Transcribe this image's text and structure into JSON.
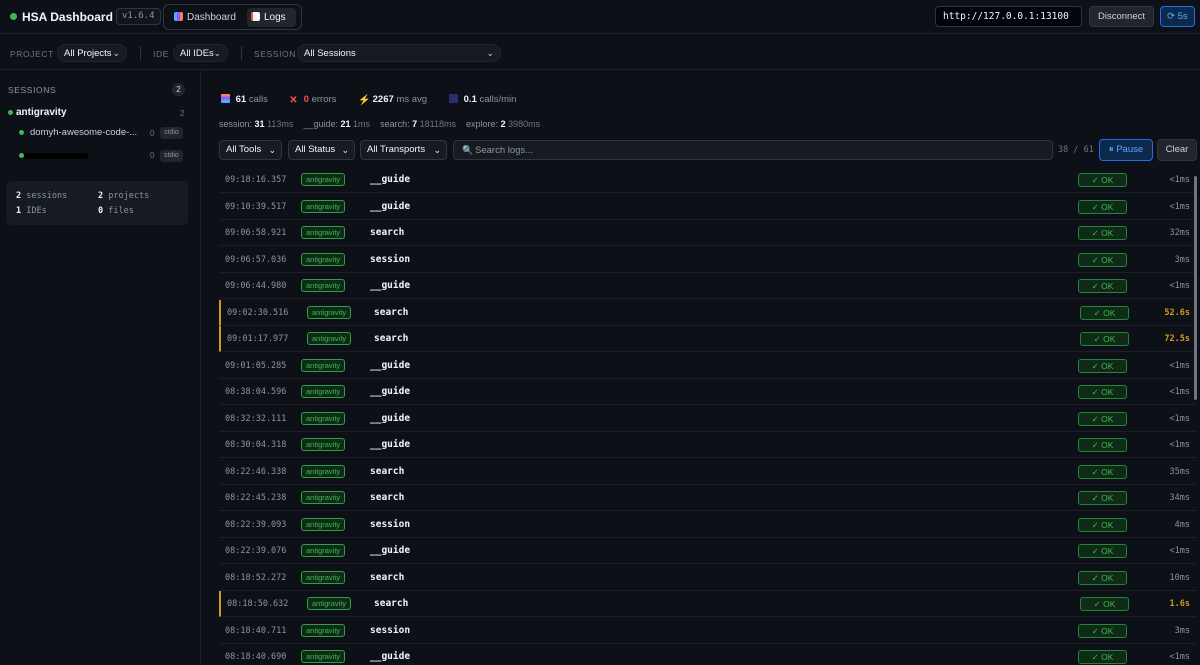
{
  "header": {
    "title": "HSA Dashboard",
    "version": "v1.6.4",
    "nav": [
      {
        "label": "Dashboard",
        "icon": "chart-icon"
      },
      {
        "label": "Logs",
        "icon": "logs-icon",
        "active": true
      }
    ],
    "server_url": "http://127.0.0.1:13100",
    "disconnect_label": "Disconnect",
    "refresh_label": "⟳ 5s"
  },
  "filters": {
    "project_label": "PROJECT",
    "project_value": "All Projects",
    "ide_label": "IDE",
    "ide_value": "All IDEs",
    "session_label": "SESSION",
    "session_value": "All Sessions"
  },
  "sidebar": {
    "title": "SESSIONS",
    "count": "2",
    "group": {
      "name": "antigravity",
      "count": "2"
    },
    "items": [
      {
        "name": "domyh-awesome-code-...",
        "num": "0",
        "badge": "stdio"
      },
      {
        "name": "",
        "num": "0",
        "badge": "stdio",
        "redacted": true
      }
    ],
    "stats": {
      "sessions_num": "2",
      "sessions_label": "sessions",
      "projects_num": "2",
      "projects_label": "projects",
      "ides_num": "1",
      "ides_label": "IDEs",
      "files_num": "0",
      "files_label": "files"
    }
  },
  "summary": {
    "calls_num": "61",
    "calls_label": "calls",
    "errors_num": "0",
    "errors_label": "errors",
    "avg_num": "2267",
    "avg_label": "ms avg",
    "rate_num": "0.1",
    "rate_label": "calls/min"
  },
  "breakdown": [
    {
      "name": "session:",
      "count": "31",
      "time": "113ms"
    },
    {
      "name": "__guide:",
      "count": "21",
      "time": "1ms"
    },
    {
      "name": "search:",
      "count": "7",
      "time": "18118ms"
    },
    {
      "name": "explore:",
      "count": "2",
      "time": "3980ms"
    }
  ],
  "toolbar": {
    "tools": "All Tools",
    "status": "All Status",
    "transports": "All Transports",
    "search_placeholder": "Search logs...",
    "count": "38 / 61",
    "pause": "⏸ Pause",
    "clear": "Clear"
  },
  "logs": [
    {
      "time": "09:18:16.357",
      "ide": "antigravity",
      "tool": "__guide",
      "status": "✓ OK",
      "duration": "<1ms",
      "slow": false
    },
    {
      "time": "09:10:39.517",
      "ide": "antigravity",
      "tool": "__guide",
      "status": "✓ OK",
      "duration": "<1ms",
      "slow": false
    },
    {
      "time": "09:06:58.921",
      "ide": "antigravity",
      "tool": "search",
      "status": "✓ OK",
      "duration": "32ms",
      "slow": false
    },
    {
      "time": "09:06:57.036",
      "ide": "antigravity",
      "tool": "session",
      "status": "✓ OK",
      "duration": "3ms",
      "slow": false
    },
    {
      "time": "09:06:44.980",
      "ide": "antigravity",
      "tool": "__guide",
      "status": "✓ OK",
      "duration": "<1ms",
      "slow": false
    },
    {
      "time": "09:02:30.516",
      "ide": "antigravity",
      "tool": "search",
      "status": "✓ OK",
      "duration": "52.6s",
      "slow": true
    },
    {
      "time": "09:01:17.977",
      "ide": "antigravity",
      "tool": "search",
      "status": "✓ OK",
      "duration": "72.5s",
      "slow": true
    },
    {
      "time": "09:01:05.285",
      "ide": "antigravity",
      "tool": "__guide",
      "status": "✓ OK",
      "duration": "<1ms",
      "slow": false
    },
    {
      "time": "08:38:04.596",
      "ide": "antigravity",
      "tool": "__guide",
      "status": "✓ OK",
      "duration": "<1ms",
      "slow": false
    },
    {
      "time": "08:32:32.111",
      "ide": "antigravity",
      "tool": "__guide",
      "status": "✓ OK",
      "duration": "<1ms",
      "slow": false
    },
    {
      "time": "08:30:04.318",
      "ide": "antigravity",
      "tool": "__guide",
      "status": "✓ OK",
      "duration": "<1ms",
      "slow": false
    },
    {
      "time": "08:22:46.338",
      "ide": "antigravity",
      "tool": "search",
      "status": "✓ OK",
      "duration": "35ms",
      "slow": false
    },
    {
      "time": "08:22:45.238",
      "ide": "antigravity",
      "tool": "search",
      "status": "✓ OK",
      "duration": "34ms",
      "slow": false
    },
    {
      "time": "08:22:39.093",
      "ide": "antigravity",
      "tool": "session",
      "status": "✓ OK",
      "duration": "4ms",
      "slow": false
    },
    {
      "time": "08:22:39.076",
      "ide": "antigravity",
      "tool": "__guide",
      "status": "✓ OK",
      "duration": "<1ms",
      "slow": false
    },
    {
      "time": "08:18:52.272",
      "ide": "antigravity",
      "tool": "search",
      "status": "✓ OK",
      "duration": "10ms",
      "slow": false
    },
    {
      "time": "08:18:50.632",
      "ide": "antigravity",
      "tool": "search",
      "status": "✓ OK",
      "duration": "1.6s",
      "slow": true
    },
    {
      "time": "08:18:40.711",
      "ide": "antigravity",
      "tool": "session",
      "status": "✓ OK",
      "duration": "3ms",
      "slow": false
    },
    {
      "time": "08:18:40.690",
      "ide": "antigravity",
      "tool": "__guide",
      "status": "✓ OK",
      "duration": "<1ms",
      "slow": false
    }
  ],
  "colors": {
    "accent": "#58a6ff",
    "ok": "#3fb950",
    "warn": "#d29922",
    "error": "#f85149",
    "bg": "#0d1117"
  }
}
